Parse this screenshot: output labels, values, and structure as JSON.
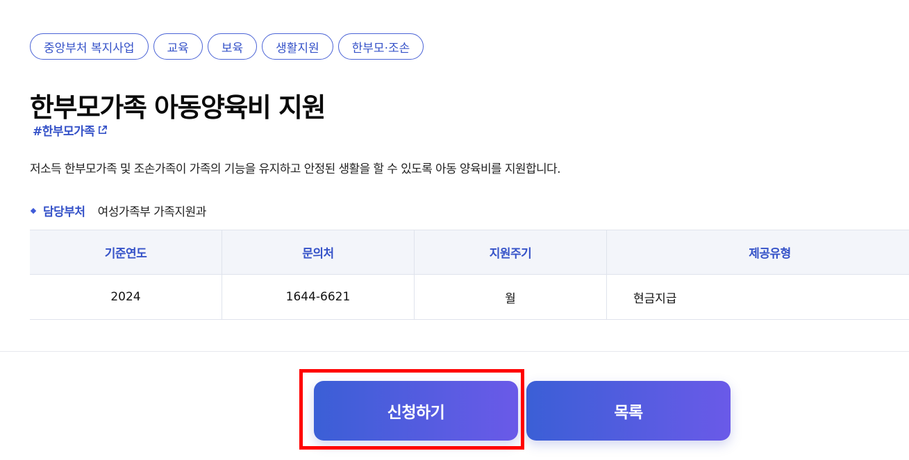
{
  "tags": [
    "중앙부처 복지사업",
    "교육",
    "보육",
    "생활지원",
    "한부모·조손"
  ],
  "title": "한부모가족 아동양육비 지원",
  "hashtag": "#한부모가족",
  "description": "저소득 한부모가족 및 조손가족이 가족의 기능을 유지하고 안정된 생활을 할 수 있도록 아동 양육비를 지원합니다.",
  "department": {
    "label": "담당부처",
    "value": "여성가족부 가족지원과"
  },
  "info_table": {
    "headers": [
      "기준연도",
      "문의처",
      "지원주기",
      "제공유형"
    ],
    "row": [
      "2024",
      "1644-6621",
      "월",
      "현금지급"
    ]
  },
  "buttons": {
    "apply": "신청하기",
    "list": "목록"
  },
  "colors": {
    "accent": "#3552c8",
    "button_start": "#3b5fd6",
    "button_end": "#6a5ae8",
    "highlight": "#ff0000"
  },
  "icons": {
    "hashtag_link": "external-link-icon",
    "department_bullet": "diamond-bullet-icon"
  }
}
